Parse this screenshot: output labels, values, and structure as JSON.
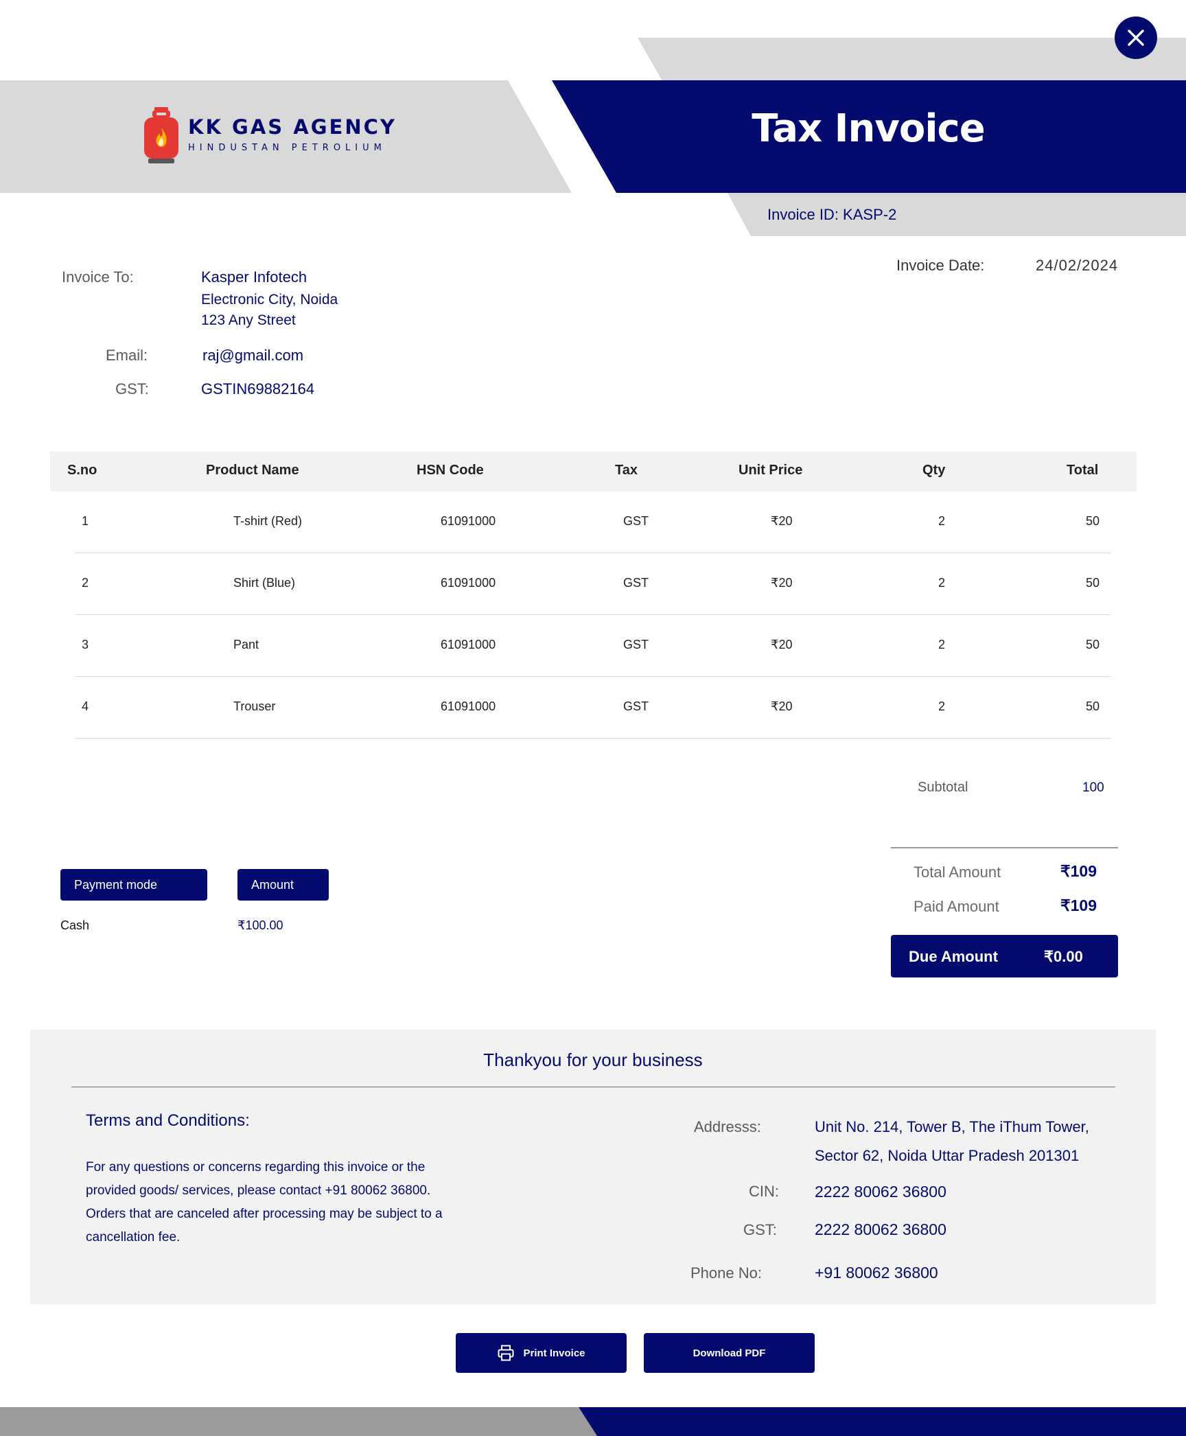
{
  "brand": {
    "name": "KK GAS AGENCY",
    "subtitle": "HINDUSTAN PETROLIUM"
  },
  "title": "Tax Invoice",
  "invoice_id": "Invoice ID: KASP-2",
  "invoice_date": {
    "label": "Invoice Date:",
    "value": "24/02/2024"
  },
  "bill_to": {
    "label": "Invoice To:",
    "name": "Kasper Infotech",
    "address_line1": "Electronic City, Noida",
    "address_line2": "123 Any Street",
    "email_label": "Email:",
    "email": "raj@gmail.com",
    "gst_label": "GST:",
    "gst": "GSTIN69882164"
  },
  "table": {
    "headers": [
      "S.no",
      "Product Name",
      "HSN Code",
      "Tax",
      "Unit Price",
      "Qty",
      "Total"
    ],
    "rows": [
      [
        "1",
        "T-shirt (Red)",
        "61091000",
        "GST",
        "₹20",
        "2",
        "50"
      ],
      [
        "2",
        "Shirt (Blue)",
        "61091000",
        "GST",
        "₹20",
        "2",
        "50"
      ],
      [
        "3",
        "Pant",
        "61091000",
        "GST",
        "₹20",
        "2",
        "50"
      ],
      [
        "4",
        "Trouser",
        "61091000",
        "GST",
        "₹20",
        "2",
        "50"
      ]
    ]
  },
  "subtotal": {
    "label": "Subtotal",
    "value": "100"
  },
  "payment": {
    "mode_label": "Payment  mode",
    "amount_label": "Amount",
    "mode": "Cash",
    "amount": "₹100.00"
  },
  "totals": {
    "total_label": "Total Amount",
    "total": "₹109",
    "paid_label": "Paid Amount",
    "paid": "₹109",
    "due_label": "Due Amount",
    "due": "₹0.00"
  },
  "footer": {
    "thanks": "Thankyou for your business",
    "terms_title": "Terms and Conditions:",
    "terms_lines": [
      "For any questions or concerns regarding this invoice or the",
      "provided goods/ services, please contact +91 80062 36800.",
      "Orders that are canceled after processing may be subject to a",
      "cancellation fee."
    ],
    "address_label": "Addresss:",
    "address_line1": "Unit No. 214, Tower B, The iThum Tower,",
    "address_line2": "Sector 62, Noida Uttar Pradesh 201301",
    "cin_label": "CIN:",
    "cin": "2222 80062 36800",
    "gst_label": "GST:",
    "gst": "2222 80062 36800",
    "phone_label": "Phone No:",
    "phone": "+91 80062 36800"
  },
  "actions": {
    "print": "Print Invoice",
    "download": "Download PDF"
  },
  "colors": {
    "navy": "#050a6e",
    "grey_band": "#d9d9d9",
    "logo_red": "#e53935"
  },
  "icons": {
    "close": "close-icon",
    "logo": "gas-cylinder-icon",
    "print": "printer-icon"
  }
}
